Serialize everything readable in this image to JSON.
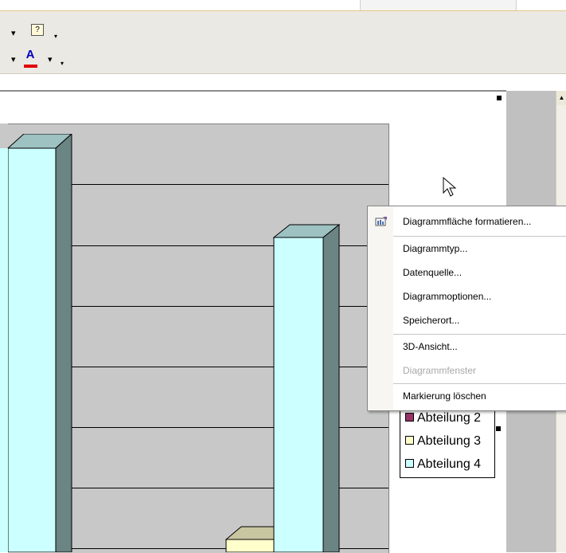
{
  "toolbar": {
    "row1_dropdown": "▾",
    "help_icon_glyph": "?",
    "row1_dropdown2": "▾",
    "row2_dropdown": "▾",
    "font_color_letter": "A",
    "row2_dropdown2": "▾",
    "row2_dropdown3": "▾"
  },
  "scroll": {
    "up_arrow": "▲"
  },
  "chart_data": {
    "type": "bar",
    "title": "",
    "xlabel": "",
    "ylabel": "",
    "series": [
      {
        "name": "Abteilung 2",
        "color": "#993366",
        "values": []
      },
      {
        "name": "Abteilung 3",
        "color": "#ffffcc",
        "values": []
      },
      {
        "name": "Abteilung 4",
        "color": "#ccffff",
        "values": []
      }
    ],
    "legend_position": "right",
    "grid": true
  },
  "legend": {
    "items": [
      {
        "label": "Abteilung 2",
        "color": "#993366"
      },
      {
        "label": "Abteilung 3",
        "color": "#ffffcc"
      },
      {
        "label": "Abteilung 4",
        "color": "#ccffff"
      }
    ]
  },
  "context_menu": {
    "items": [
      {
        "label": "Diagrammfläche formatieren...",
        "enabled": true,
        "icon": "format-chart-area-icon"
      },
      {
        "label": "Diagrammtyp...",
        "enabled": true
      },
      {
        "label": "Datenquelle...",
        "enabled": true
      },
      {
        "label": "Diagrammoptionen...",
        "enabled": true
      },
      {
        "label": "Speicherort...",
        "enabled": true
      },
      {
        "label": "3D-Ansicht...",
        "enabled": true
      },
      {
        "label": "Diagrammfenster",
        "enabled": false
      },
      {
        "label": "Markierung löschen",
        "enabled": true
      }
    ]
  }
}
